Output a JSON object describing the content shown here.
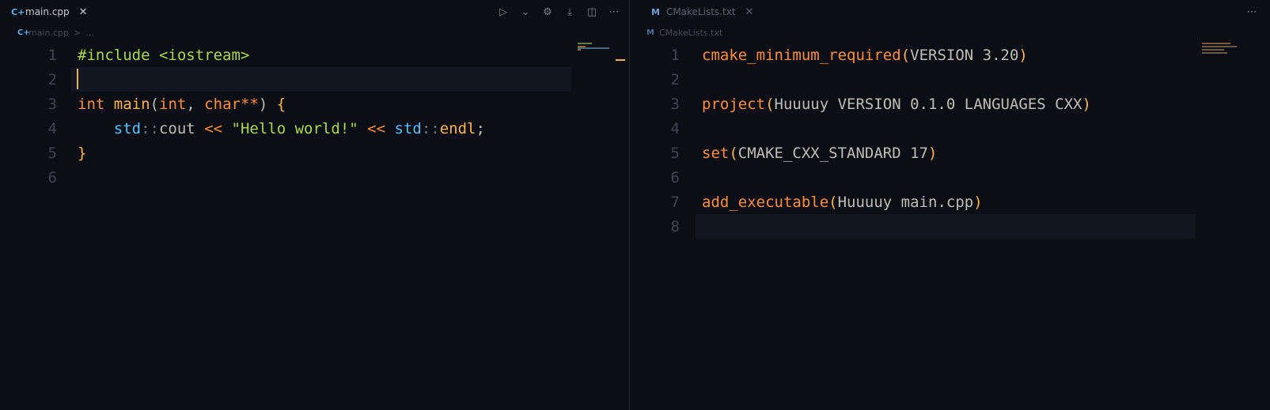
{
  "colors": {
    "background": "#0b0e14",
    "line_number": "#3f4552",
    "keyword": "#ff8f40",
    "function": "#ffb454",
    "string": "#aad94c",
    "namespace": "#59c2ff",
    "text": "#bfbdb6",
    "cursor": "#e6b450",
    "current_line": "#121620"
  },
  "left_editor": {
    "tab": {
      "icon": "cpp-file-icon",
      "icon_glyph": "C+",
      "label": "main.cpp",
      "close": "✕"
    },
    "toolbar": [
      {
        "name": "run-icon",
        "glyph": "▷"
      },
      {
        "name": "chevron-down-icon",
        "glyph": "⌄"
      },
      {
        "name": "gear-icon",
        "glyph": "⚙"
      },
      {
        "name": "save-download-icon",
        "glyph": "⤓"
      },
      {
        "name": "split-editor-icon",
        "glyph": "◫"
      },
      {
        "name": "more-actions-icon",
        "glyph": "⋯"
      }
    ],
    "breadcrumb": {
      "file": "main.cpp",
      "separator": ">",
      "more": "..."
    },
    "lines": [
      {
        "number": "1",
        "tokens": [
          {
            "t": "#include",
            "c": "str-green"
          },
          {
            "t": " ",
            "c": "plain"
          },
          {
            "t": "<iostream>",
            "c": "str-green"
          }
        ]
      },
      {
        "number": "2",
        "tokens": []
      },
      {
        "number": "3",
        "tokens": [
          {
            "t": "int",
            "c": "kw-orange"
          },
          {
            "t": " ",
            "c": "plain"
          },
          {
            "t": "main",
            "c": "fn-yellow"
          },
          {
            "t": "(",
            "c": "plain"
          },
          {
            "t": "int",
            "c": "kw-orange"
          },
          {
            "t": ", ",
            "c": "plain"
          },
          {
            "t": "char",
            "c": "kw-orange"
          },
          {
            "t": "**",
            "c": "kw-orange"
          },
          {
            "t": ") ",
            "c": "plain"
          },
          {
            "t": "{",
            "c": "brace"
          }
        ]
      },
      {
        "number": "4",
        "tokens": [
          {
            "t": "    ",
            "c": "plain"
          },
          {
            "t": "std",
            "c": "ns-blue"
          },
          {
            "t": "::",
            "c": "sep"
          },
          {
            "t": "cout",
            "c": "plain"
          },
          {
            "t": " ",
            "c": "plain"
          },
          {
            "t": "<<",
            "c": "kw-orange"
          },
          {
            "t": " ",
            "c": "plain"
          },
          {
            "t": "\"Hello world!\"",
            "c": "str-green"
          },
          {
            "t": " ",
            "c": "plain"
          },
          {
            "t": "<<",
            "c": "kw-orange"
          },
          {
            "t": " ",
            "c": "plain"
          },
          {
            "t": "std",
            "c": "ns-blue"
          },
          {
            "t": "::",
            "c": "sep"
          },
          {
            "t": "endl",
            "c": "fn-yellow"
          },
          {
            "t": ";",
            "c": "plain"
          }
        ]
      },
      {
        "number": "5",
        "tokens": [
          {
            "t": "}",
            "c": "brace"
          }
        ]
      },
      {
        "number": "6",
        "tokens": []
      }
    ],
    "current_line": 2
  },
  "right_editor": {
    "tab": {
      "icon": "cmake-file-icon",
      "icon_glyph": "M",
      "label": "CMakeLists.txt",
      "close": "✕"
    },
    "toolbar": [
      {
        "name": "more-actions-icon",
        "glyph": "⋯"
      }
    ],
    "breadcrumb": {
      "file": "CMakeLists.txt"
    },
    "lines": [
      {
        "number": "1",
        "tokens": [
          {
            "t": "cmake_minimum_required",
            "c": "kw-orange"
          },
          {
            "t": "(",
            "c": "fn-yellow"
          },
          {
            "t": "VERSION 3.20",
            "c": "plain"
          },
          {
            "t": ")",
            "c": "fn-yellow"
          }
        ]
      },
      {
        "number": "2",
        "tokens": []
      },
      {
        "number": "3",
        "tokens": [
          {
            "t": "project",
            "c": "kw-orange"
          },
          {
            "t": "(",
            "c": "fn-yellow"
          },
          {
            "t": "Huuuuy VERSION 0.1.0 LANGUAGES CXX",
            "c": "plain"
          },
          {
            "t": ")",
            "c": "fn-yellow"
          }
        ]
      },
      {
        "number": "4",
        "tokens": []
      },
      {
        "number": "5",
        "tokens": [
          {
            "t": "set",
            "c": "kw-orange"
          },
          {
            "t": "(",
            "c": "fn-yellow"
          },
          {
            "t": "CMAKE_CXX_STANDARD 17",
            "c": "plain"
          },
          {
            "t": ")",
            "c": "fn-yellow"
          }
        ]
      },
      {
        "number": "6",
        "tokens": []
      },
      {
        "number": "7",
        "tokens": [
          {
            "t": "add_executable",
            "c": "kw-orange"
          },
          {
            "t": "(",
            "c": "fn-yellow"
          },
          {
            "t": "Huuuuy main.cpp",
            "c": "plain"
          },
          {
            "t": ")",
            "c": "fn-yellow"
          }
        ]
      },
      {
        "number": "8",
        "tokens": []
      }
    ],
    "current_line": 8
  }
}
